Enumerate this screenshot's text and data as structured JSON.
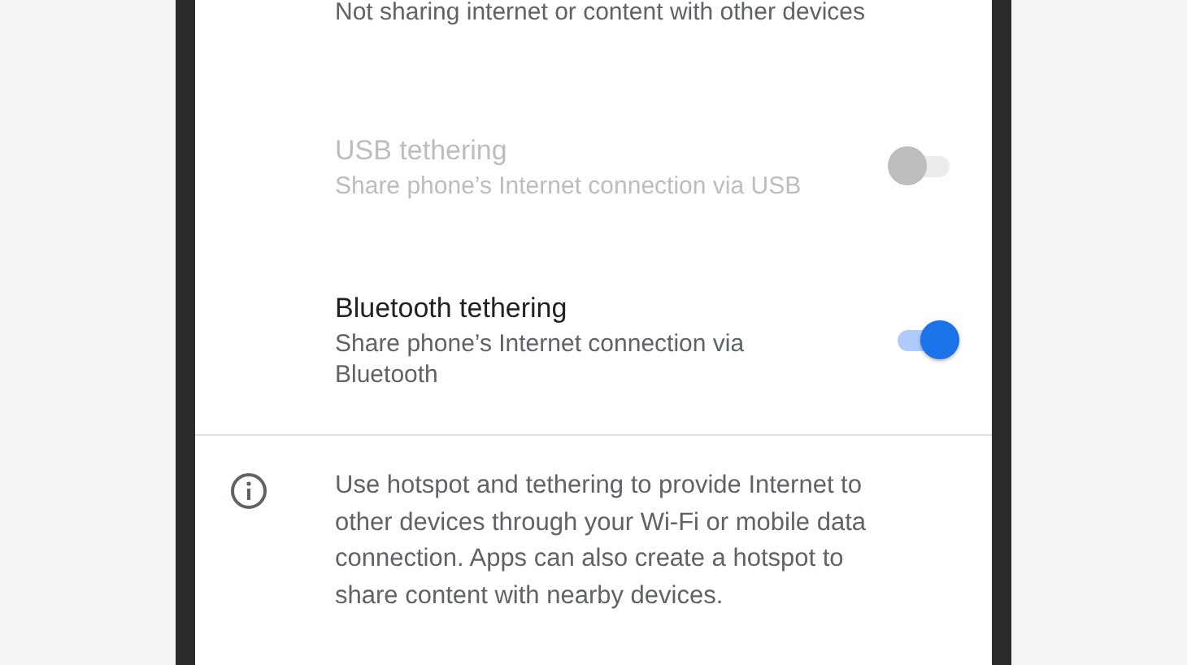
{
  "summary": "Not sharing internet or content with other devices",
  "settings": [
    {
      "title": "USB tethering",
      "subtitle": "Share phone’s Internet connection via USB",
      "disabled": true,
      "on": false
    },
    {
      "title": "Bluetooth tethering",
      "subtitle": "Share phone’s Internet connection via Bluetooth",
      "disabled": false,
      "on": true
    }
  ],
  "info": "Use hotspot and tethering to provide Internet to other devices through your Wi-Fi or mobile data connection. Apps can also create a hotspot to share content with nearby devices."
}
